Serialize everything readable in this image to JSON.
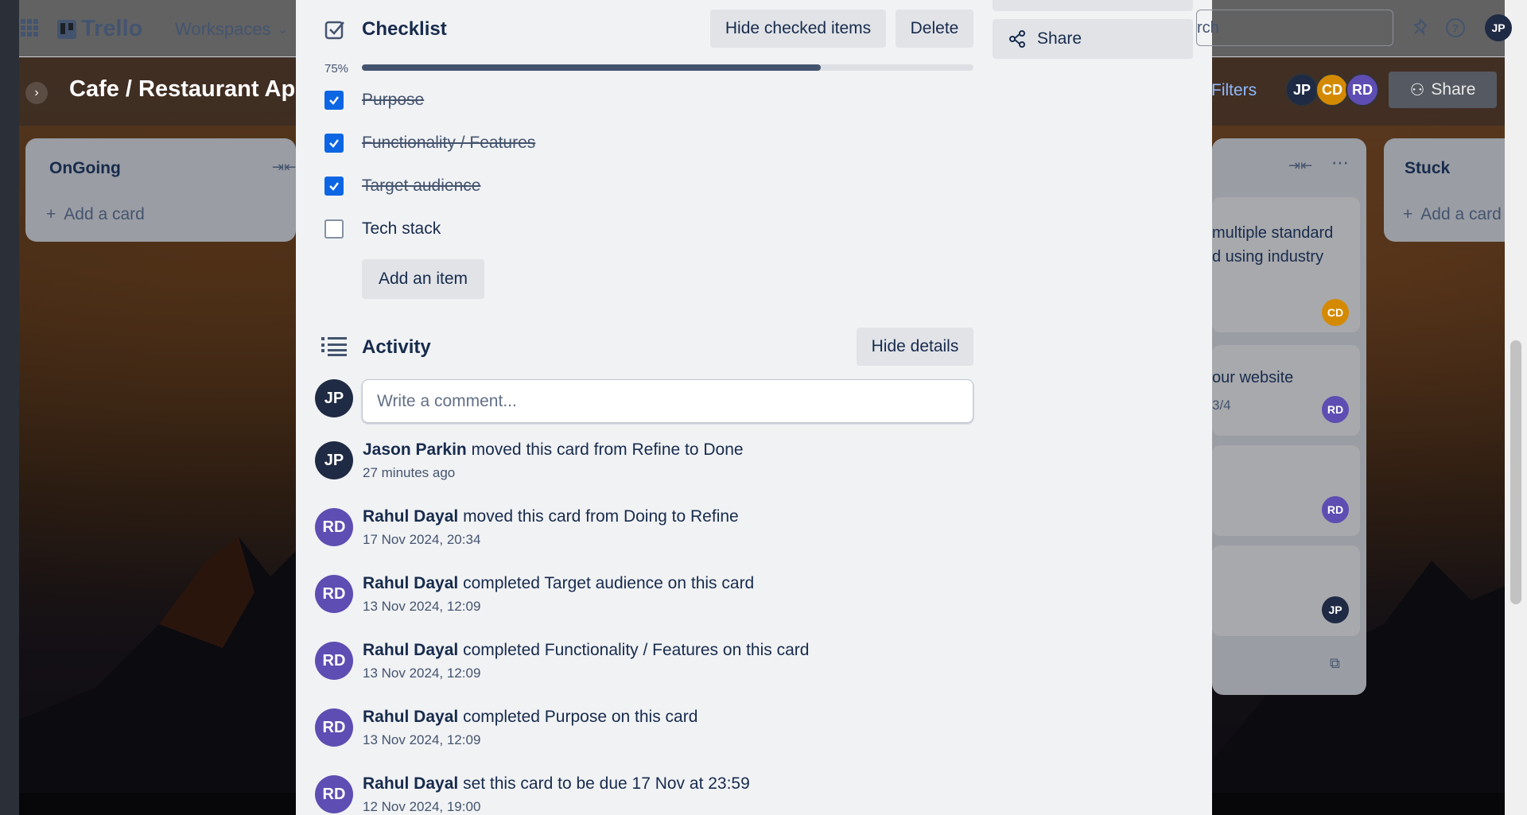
{
  "header": {
    "app_name": "Trello",
    "workspaces_label": "Workspaces",
    "search_placeholder": "rch",
    "user_initials": "JP"
  },
  "board": {
    "title": "Cafe / Restaurant App",
    "filters_label": "Filters",
    "share_label": "Share",
    "members": [
      {
        "initials": "JP",
        "color": "#1f2a44"
      },
      {
        "initials": "CD",
        "color": "#d48a00"
      },
      {
        "initials": "RD",
        "color": "#5e4db2"
      }
    ],
    "lists": [
      {
        "title": "OnGoing",
        "add_label": "Add a card"
      },
      {
        "title": "Stuck",
        "add_label": "Add a card"
      }
    ],
    "card_snippets": [
      {
        "text_line1": "multiple standard",
        "text_line2": "d using industry",
        "avatar": "CD",
        "avatar_color": "#d48a00"
      },
      {
        "text_line1": "our website",
        "text_line2": "3/4",
        "avatar": "RD",
        "avatar_color": "#5e4db2"
      },
      {
        "avatar": "RD",
        "avatar_color": "#5e4db2"
      },
      {
        "avatar": "JP",
        "avatar_color": "#1f2a44"
      }
    ]
  },
  "modal": {
    "sidebar_share_label": "Share",
    "checklist": {
      "title": "Checklist",
      "hide_checked_label": "Hide checked items",
      "delete_label": "Delete",
      "progress_text": "75%",
      "progress_value": 0.75,
      "items": [
        {
          "label": "Purpose",
          "checked": true
        },
        {
          "label": "Functionality / Features",
          "checked": true
        },
        {
          "label": "Target audience",
          "checked": true
        },
        {
          "label": "Tech stack",
          "checked": false
        }
      ],
      "add_item_label": "Add an item"
    },
    "activity": {
      "title": "Activity",
      "hide_details_label": "Hide details",
      "comment_placeholder": "Write a comment...",
      "current_user_initials": "JP",
      "entries": [
        {
          "initials": "JP",
          "color": "#1f2a44",
          "user": "Jason Parkin",
          "action": "moved this card from Refine to Done",
          "time": "27 minutes ago"
        },
        {
          "initials": "RD",
          "color": "#5e4db2",
          "user": "Rahul Dayal",
          "action": "moved this card from Doing to Refine",
          "time": "17 Nov 2024, 20:34"
        },
        {
          "initials": "RD",
          "color": "#5e4db2",
          "user": "Rahul Dayal",
          "action": "completed Target audience on this card",
          "time": "13 Nov 2024, 12:09"
        },
        {
          "initials": "RD",
          "color": "#5e4db2",
          "user": "Rahul Dayal",
          "action": "completed Functionality / Features on this card",
          "time": "13 Nov 2024, 12:09"
        },
        {
          "initials": "RD",
          "color": "#5e4db2",
          "user": "Rahul Dayal",
          "action": "completed Purpose on this card",
          "time": "13 Nov 2024, 12:09"
        },
        {
          "initials": "RD",
          "color": "#5e4db2",
          "user": "Rahul Dayal",
          "action": "set this card to be due 17 Nov at 23:59",
          "time": "12 Nov 2024, 19:00"
        }
      ]
    }
  }
}
